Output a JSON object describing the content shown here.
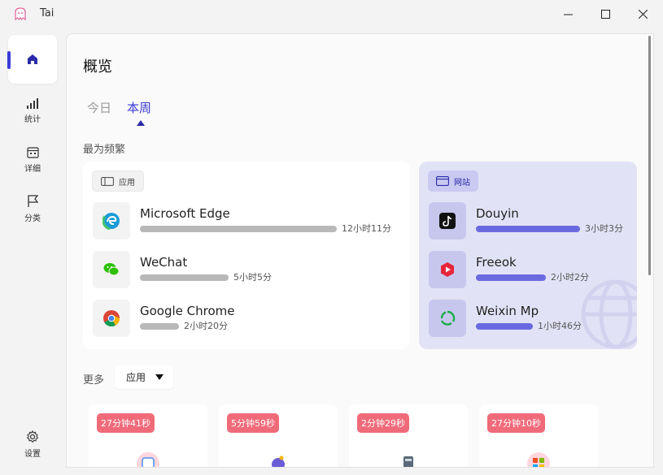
{
  "window": {
    "title": "Tai"
  },
  "nav": {
    "items": [
      {
        "label": ""
      },
      {
        "label": "统计"
      },
      {
        "label": "详细"
      },
      {
        "label": "分类"
      }
    ],
    "settings_label": "设置"
  },
  "overview": {
    "title": "概览",
    "tabs": [
      {
        "label": "今日"
      },
      {
        "label": "本周"
      }
    ],
    "active_tab": "本周",
    "frequent_label": "最为频繁",
    "apps": {
      "chip_label": "应用",
      "rows": [
        {
          "name": "Microsoft Edge",
          "time": "12小时11分",
          "fraction": 1.0
        },
        {
          "name": "WeChat",
          "time": "5小时5分",
          "fraction": 0.45
        },
        {
          "name": "Google Chrome",
          "time": "2小时20分",
          "fraction": 0.2
        }
      ]
    },
    "sites": {
      "chip_label": "网站",
      "rows": [
        {
          "name": "Douyin",
          "time": "3小时3分",
          "fraction": 1.0
        },
        {
          "name": "Freeok",
          "time": "2小时2分",
          "fraction": 0.67
        },
        {
          "name": "Weixin Mp",
          "time": "1小时46分",
          "fraction": 0.55
        }
      ]
    },
    "more_label": "更多",
    "more_dropdown": {
      "selected": "应用"
    },
    "tiles": [
      {
        "badge": "27分钟41秒"
      },
      {
        "badge": "5分钟59秒"
      },
      {
        "badge": "2分钟29秒"
      },
      {
        "badge": "27分钟10秒"
      }
    ]
  },
  "colors": {
    "accent": "#3b3bd6",
    "site_card_bg": "#e2e2f6",
    "site_bar": "#6a6ae0",
    "app_bar": "#b8b8b8",
    "badge": "#f06b7a"
  }
}
